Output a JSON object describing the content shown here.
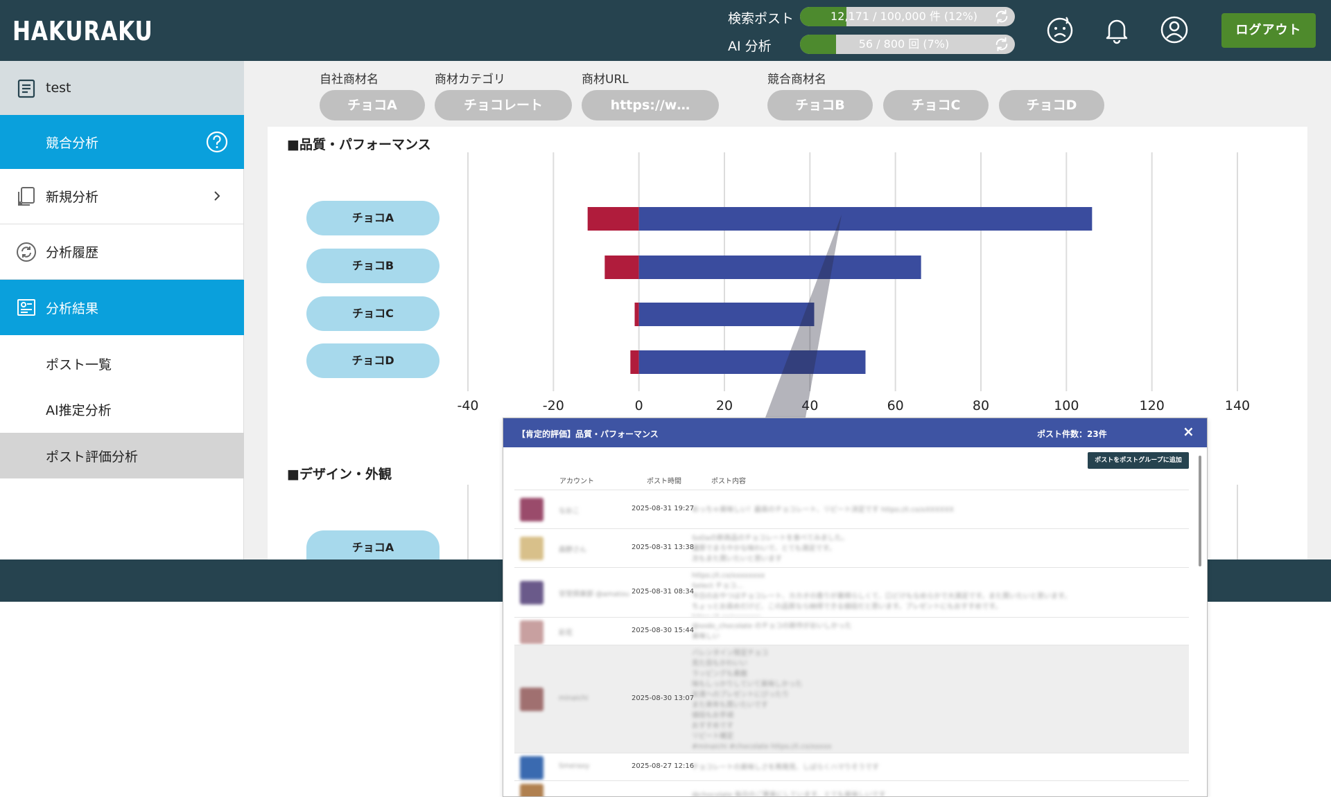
{
  "header": {
    "logo_text": "HAKURAKU",
    "usage": [
      {
        "label": "検索ポスト",
        "text": "12,171 / 100,000 件 (12%)",
        "percent": 12
      },
      {
        "label": "AI 分析",
        "text": "56 / 800 回 (7%)",
        "percent": 7
      }
    ],
    "icons": [
      "mood-icon",
      "bell-icon",
      "user-icon"
    ],
    "logout_label": "ログアウト"
  },
  "sidebar": {
    "project": "test",
    "items": [
      {
        "label": "競合分析",
        "icon": "help-circle-icon"
      },
      {
        "label": "新規分析",
        "icon": "new-document-icon"
      },
      {
        "label": "分析履歴",
        "icon": "history-icon"
      },
      {
        "label": "分析結果",
        "icon": "result-icon"
      }
    ],
    "sub_items": [
      {
        "label": "ポスト一覧"
      },
      {
        "label": "AI推定分析"
      },
      {
        "label": "ポスト評価分析"
      }
    ]
  },
  "filters": {
    "own_label": "自社商材名",
    "category_label": "商材カテゴリ",
    "url_label": "商材URL",
    "competitor_label": "競合商材名",
    "own_value": "チョコA",
    "category_value": "チョコレート",
    "url_value": "https://w…",
    "competitors": [
      "チョコB",
      "チョコC",
      "チョコD"
    ]
  },
  "sections": {
    "quality_title": "■品質・パフォーマンス",
    "design_title": "■デザイン・外観",
    "design_first_item": "チョコA"
  },
  "chart_data": {
    "type": "bar",
    "orientation": "horizontal",
    "stacked": true,
    "title": "■品質・パフォーマンス",
    "categories": [
      "チョコA",
      "チョコB",
      "チョコC",
      "チョコD"
    ],
    "series": [
      {
        "values": [
          -12,
          -8,
          -1,
          -2
        ],
        "color": "#b01c3c"
      },
      {
        "values": [
          106,
          66,
          41,
          53
        ],
        "color": "#3a4c9e"
      }
    ],
    "xlim": [
      -40,
      140
    ],
    "xticks": [
      "-40",
      "-20",
      "0",
      "20",
      "40",
      "60",
      "80",
      "100",
      "120",
      "140"
    ],
    "grid": true
  },
  "modal": {
    "title": "【肯定的評価】品質・パフォーマンス",
    "count": "ポスト件数：23件",
    "close": "×",
    "add_button": "ポストをポストグループに追加",
    "columns": [
      "アカウント",
      "ポスト時間",
      "ポスト内容"
    ],
    "rows": [
      {
        "account": "なおこ",
        "time": "2025-08-31 19:27",
        "content": [
          "めっちゃ美味しい！最高のチョコレート、リピート決定です https://t.co/xXXXXXX"
        ]
      },
      {
        "account": "森野さん",
        "time": "2025-08-31 13:38",
        "content": [
          "SoDaの新商品のチョコレートを食べてみました。",
          "濃厚でまろやかな味わいで、とても満足です。",
          "次もまた買いたいと思います"
        ]
      },
      {
        "account": "甘党倶楽部 @amatou",
        "time": "2025-08-31 08:34",
        "content": [
          "https://t.co/xxxxxxxx",
          "Select チョコ…",
          "今日のおやつはチョコレート、カカオの香りが素晴らしくて、口どけもなめらかで大満足です。また買いたいと思います。",
          "ちょっとお高めだけど、この品質なら納得できる値段だと思います。プレゼントにもおすすめです。",
          "https://t.co/xxxxxxx"
        ]
      },
      {
        "account": "彩花",
        "time": "2025-08-30 15:44",
        "content": [
          "@sodo_chocolate のチョコの新作がおいしかった",
          "美味しい"
        ]
      },
      {
        "account": "minaichi",
        "time": "2025-08-30 13:07",
        "content": [
          "バレンタイン限定チョコ",
          "見た目もかわいい",
          "ラッピングも素敵",
          "味もしっかりしていて美味しかった",
          "友達へのプレゼントにぴったり",
          "また来年も買いたいです",
          "値段もお手頃",
          "おすすめです",
          "リピート確定",
          "#minaichi #chocolate https://t.co/xxxxx"
        ]
      },
      {
        "account": "Smeraxy",
        "time": "2025-08-27 12:16",
        "content": [
          "チョコレートの美味しさを再発見、しばらくハマりそうです"
        ]
      },
      {
        "account": "",
        "time": "",
        "content": [
          "@chocolate 毎日のご褒美にしています、とても美味しいです"
        ]
      }
    ]
  }
}
